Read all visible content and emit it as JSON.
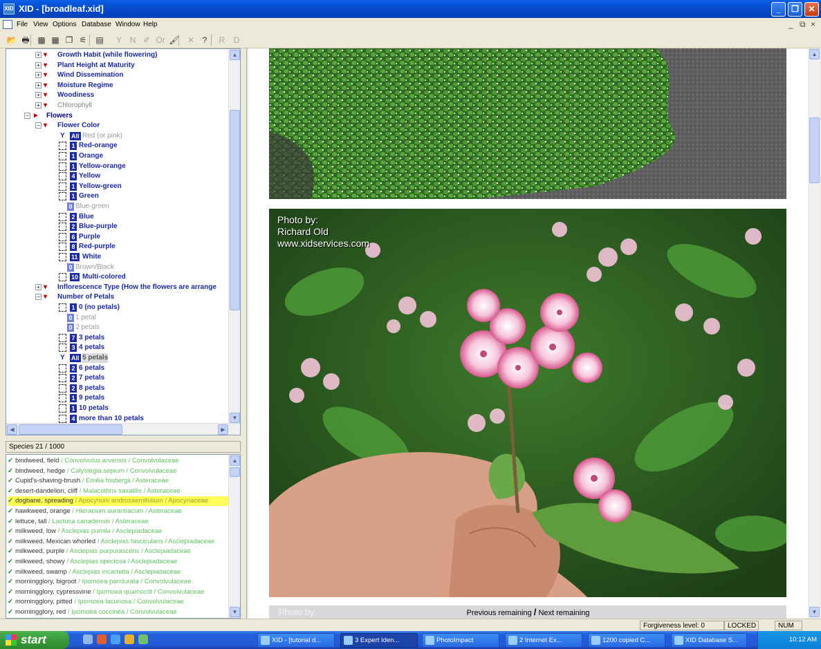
{
  "window": {
    "title": "XID - [broadleaf.xid]",
    "app_icon": "XID"
  },
  "menu": {
    "items": [
      "File",
      "View",
      "Options",
      "Database",
      "Window",
      "Help"
    ],
    "mdi_controls": [
      "_",
      "⧉",
      "×"
    ]
  },
  "toolbar": {
    "buttons": [
      {
        "icon": "open-folder-icon",
        "glyph": "📂",
        "disabled": false
      },
      {
        "icon": "print-icon",
        "glyph": "🖶",
        "disabled": false
      },
      {
        "icon": "grid-icon",
        "glyph": "▦",
        "disabled": false
      },
      {
        "icon": "grid-alt-icon",
        "glyph": "▦",
        "disabled": false
      },
      {
        "icon": "copy-icon",
        "glyph": "❐",
        "disabled": false
      },
      {
        "icon": "filter-icon",
        "glyph": "⚟",
        "disabled": false
      },
      {
        "icon": "tree-icon",
        "glyph": "▤",
        "disabled": false
      },
      {
        "icon": "y-icon",
        "glyph": "Y",
        "disabled": true
      },
      {
        "icon": "n-icon",
        "glyph": "N",
        "disabled": true
      },
      {
        "icon": "pen-icon",
        "glyph": "✐",
        "disabled": true
      },
      {
        "icon": "or-icon",
        "glyph": "Or",
        "disabled": true
      },
      {
        "icon": "brush-icon",
        "glyph": "🖌",
        "disabled": false
      },
      {
        "icon": "close-x-icon",
        "glyph": "✕",
        "disabled": true
      },
      {
        "icon": "help-icon",
        "glyph": "?",
        "disabled": false
      },
      {
        "icon": "r-icon",
        "glyph": "R",
        "disabled": true
      },
      {
        "icon": "d-icon",
        "glyph": "D",
        "disabled": true
      }
    ]
  },
  "tree": {
    "top_groups": [
      {
        "label": "Growth Habit (while flowering)",
        "gray": false
      },
      {
        "label": "Plant Height at Maturity",
        "gray": false
      },
      {
        "label": "Wind Dissemination",
        "gray": false
      },
      {
        "label": "Moisture Regime",
        "gray": false
      },
      {
        "label": "Woodiness",
        "gray": false
      },
      {
        "label": "Chlorophyll",
        "gray": true
      }
    ],
    "flowers_label": "Flowers",
    "flower_color_label": "Flower Color",
    "flower_color_options": [
      {
        "type": "y",
        "badge": "All",
        "label": "Red (or pink)",
        "state": "y"
      },
      {
        "type": "c",
        "badge": "1",
        "label": "Red-orange",
        "state": "on"
      },
      {
        "type": "c",
        "badge": "1",
        "label": "Orange",
        "state": "on"
      },
      {
        "type": "c",
        "badge": "1",
        "label": "Yellow-orange",
        "state": "on"
      },
      {
        "type": "c",
        "badge": "4",
        "label": "Yellow",
        "state": "on"
      },
      {
        "type": "c",
        "badge": "1",
        "label": "Yellow-green",
        "state": "on"
      },
      {
        "type": "c",
        "badge": "1",
        "label": "Green",
        "state": "on"
      },
      {
        "type": "z",
        "badge": "0",
        "label": "Blue-green",
        "state": "off"
      },
      {
        "type": "c",
        "badge": "2",
        "label": "Blue",
        "state": "on"
      },
      {
        "type": "c",
        "badge": "2",
        "label": "Blue-purple",
        "state": "on"
      },
      {
        "type": "c",
        "badge": "6",
        "label": "Purple",
        "state": "on"
      },
      {
        "type": "c",
        "badge": "8",
        "label": "Red-purple",
        "state": "on"
      },
      {
        "type": "c",
        "badge": "11",
        "label": "White",
        "state": "on"
      },
      {
        "type": "z",
        "badge": "0",
        "label": "Brown/Black",
        "state": "off"
      },
      {
        "type": "c",
        "badge": "10",
        "label": "Multi-colored",
        "state": "on"
      }
    ],
    "inflorescence_label": "Inflorescence Type (How the flowers are arrange",
    "petals_label": "Number of Petals",
    "petal_options": [
      {
        "type": "c",
        "badge": "1",
        "label": "0 (no petals)",
        "state": "on"
      },
      {
        "type": "z",
        "badge": "0",
        "label": "1 petal",
        "state": "off"
      },
      {
        "type": "z",
        "badge": "0",
        "label": "2 petals",
        "state": "off"
      },
      {
        "type": "c",
        "badge": "7",
        "label": "3 petals",
        "state": "on"
      },
      {
        "type": "c",
        "badge": "3",
        "label": "4 petals",
        "state": "on"
      },
      {
        "type": "y",
        "badge": "All",
        "label": "5 petals",
        "state": "sel"
      },
      {
        "type": "c",
        "badge": "2",
        "label": "6 petals",
        "state": "on"
      },
      {
        "type": "c",
        "badge": "2",
        "label": "7 petals",
        "state": "on"
      },
      {
        "type": "c",
        "badge": "2",
        "label": "8 petals",
        "state": "on"
      },
      {
        "type": "c",
        "badge": "1",
        "label": "9 petals",
        "state": "on"
      },
      {
        "type": "c",
        "badge": "1",
        "label": "10 petals",
        "state": "on"
      },
      {
        "type": "c",
        "badge": "4",
        "label": "more than 10 petals",
        "state": "on"
      }
    ]
  },
  "species": {
    "header": "Species 21 / 1000",
    "items": [
      {
        "common": "bindweed, field",
        "sci": "Convolvulus arvensis / Convolvulaceae",
        "highlight": false
      },
      {
        "common": "bindweed, hedge",
        "sci": "Calystegia sepium / Convolvulaceae",
        "highlight": false
      },
      {
        "common": "Cupid's-shaving-brush",
        "sci": "Emilia fosbergii / Asteraceae",
        "highlight": false
      },
      {
        "common": "desert-dandelion, cliff",
        "sci": "Malacothrix saxatilis / Asteraceae",
        "highlight": false
      },
      {
        "common": "dogbane, spreading",
        "sci": "Apocynum androsaemifolium / Apocynaceae",
        "highlight": true
      },
      {
        "common": "hawkweed, orange",
        "sci": "Hieracium aurantiacum / Asteraceae",
        "highlight": false
      },
      {
        "common": "lettuce, tall",
        "sci": "Lactuca canadensis / Asteraceae",
        "highlight": false
      },
      {
        "common": "milkweed, low",
        "sci": "Asclepias pumila / Asclepiadaceae",
        "highlight": false
      },
      {
        "common": "milkweed, Mexican whorled",
        "sci": "Asclepias fascicularis / Asclepiadaceae",
        "highlight": false
      },
      {
        "common": "milkweed, purple",
        "sci": "Asclepias purpurascens / Asclepiadaceae",
        "highlight": false
      },
      {
        "common": "milkweed, showy",
        "sci": "Asclepias speciosa / Asclepiadaceae",
        "highlight": false
      },
      {
        "common": "milkweed, swamp",
        "sci": "Asclepias incarnata / Asclepiadaceae",
        "highlight": false
      },
      {
        "common": "morningglory, bigroot",
        "sci": "Ipomoea pandurata / Convolvulaceae",
        "highlight": false
      },
      {
        "common": "morningglory, cypressvine",
        "sci": "Ipomoea quamoclit / Convolvulaceae",
        "highlight": false
      },
      {
        "common": "morningglory, pitted",
        "sci": "Ipomoea lacunosa / Convolvulaceae",
        "highlight": false
      },
      {
        "common": "morningglory, red",
        "sci": "Ipomoea coccinea / Convolvulaceae",
        "highlight": false
      }
    ]
  },
  "image_pane": {
    "credit_line1": "Photo by:",
    "credit_line2": "Richard Old",
    "credit_line3": "www.xidservices.com",
    "peek_text": "Photo by:",
    "nav_prev": "Previous remaining",
    "nav_sep": "/",
    "nav_next": "Next remaining"
  },
  "status": {
    "forgiveness": "Forgiveness level: 0",
    "locked": "LOCKED",
    "num": "NUM"
  },
  "taskbar": {
    "start": "start",
    "tasks": [
      {
        "label": "XID - [tutorial d...",
        "active": false
      },
      {
        "label": "3 Expert Iden...",
        "active": true
      },
      {
        "label": "PhotoImpact",
        "active": false
      },
      {
        "label": "2 Internet Ex...",
        "active": false
      },
      {
        "label": "1200 copied C...",
        "active": false
      },
      {
        "label": "XID Database S...",
        "active": false
      }
    ],
    "clock": "10:12 AM"
  }
}
